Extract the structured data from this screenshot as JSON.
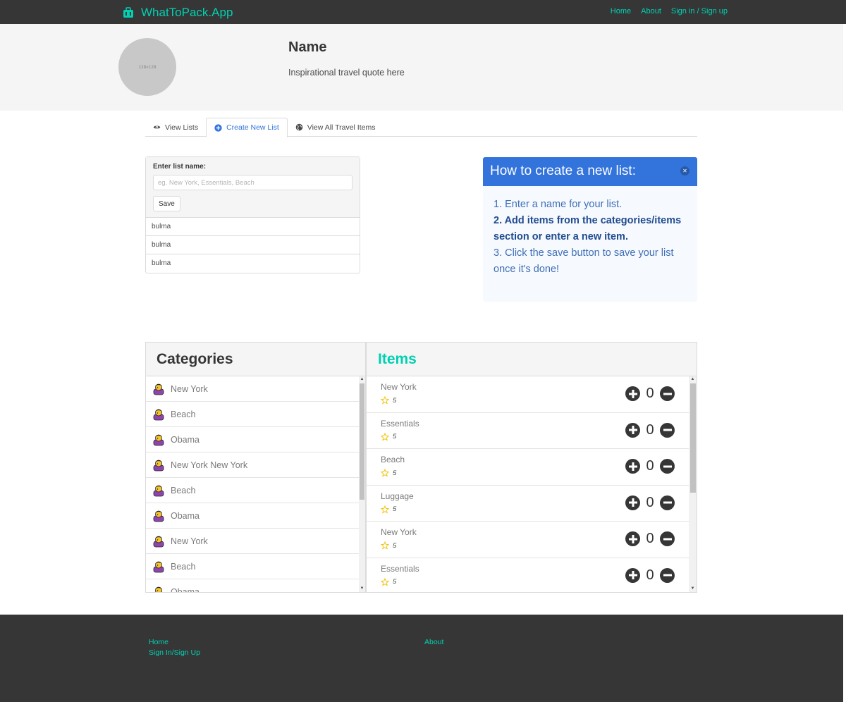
{
  "navbar": {
    "brand": "WhatToPack.App",
    "links": [
      "Home",
      "About",
      "Sign in / Sign up"
    ]
  },
  "hero": {
    "avatar_placeholder": "128×128",
    "name": "Name",
    "quote": "Inspirational travel quote here"
  },
  "tabs": [
    {
      "label": "View Lists",
      "icon": "eye-icon"
    },
    {
      "label": "Create New List",
      "icon": "plus-circle-icon"
    },
    {
      "label": "View All Travel Items",
      "icon": "globe-icon"
    }
  ],
  "active_tab": "Create New List",
  "create_list": {
    "label": "Enter list name:",
    "placeholder": "eg. New York, Essentials, Beach",
    "value": "",
    "save_label": "Save",
    "items": [
      "bulma",
      "bulma",
      "bulma"
    ]
  },
  "howto": {
    "title": "How to create a new list:",
    "steps": [
      "1. Enter a name for your list.",
      "2. Add items from the categories/items section or enter a new item.",
      "3. Click the save button to save your list once it's done!"
    ]
  },
  "categories": {
    "title": "Categories",
    "items": [
      "New York",
      "Beach",
      "Obama",
      "New York New York",
      "Beach",
      "Obama",
      "New York",
      "Beach",
      "Obama"
    ]
  },
  "items_panel": {
    "title": "Items",
    "items": [
      {
        "name": "New York",
        "rating": "5",
        "quantity": "0"
      },
      {
        "name": "Essentials",
        "rating": "5",
        "quantity": "0"
      },
      {
        "name": "Beach",
        "rating": "5",
        "quantity": "0"
      },
      {
        "name": "Luggage",
        "rating": "5",
        "quantity": "0"
      },
      {
        "name": "New York",
        "rating": "5",
        "quantity": "0"
      },
      {
        "name": "Essentials",
        "rating": "5",
        "quantity": "0"
      }
    ]
  },
  "footer": {
    "links": [
      "Home",
      "Sign In/Sign Up",
      "About"
    ]
  },
  "colors": {
    "primary": "#00d1b2",
    "link": "#3273dc",
    "dark": "#363636"
  }
}
